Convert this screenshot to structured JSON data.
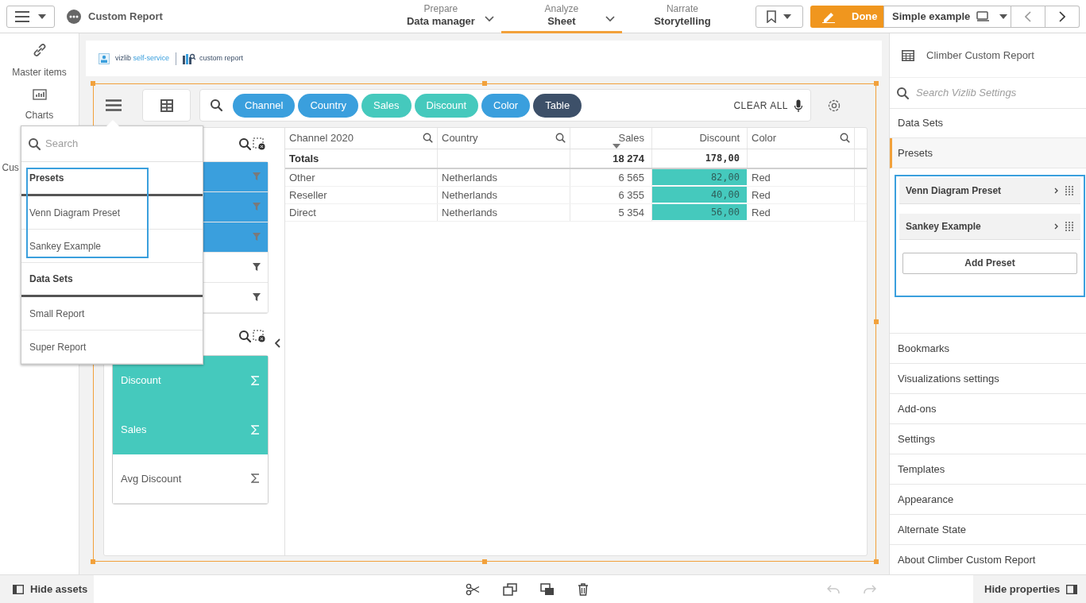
{
  "top_bar": {
    "title": "Custom Report",
    "tabs": [
      {
        "caption": "Prepare",
        "label": "Data manager",
        "selected": false,
        "dropdown": true
      },
      {
        "caption": "Analyze",
        "label": "Sheet",
        "selected": true,
        "dropdown": true
      },
      {
        "caption": "Narrate",
        "label": "Storytelling",
        "selected": false,
        "dropdown": false
      }
    ],
    "done_button": "Done",
    "sheet_button": "Simple example"
  },
  "assets_panel": {
    "items": [
      {
        "kind": "link",
        "label": "Master items"
      },
      {
        "kind": "chart",
        "label": "Charts"
      },
      {
        "kind": "text",
        "label": "Cus"
      }
    ]
  },
  "report_header": {
    "brand": "vizlib",
    "brand_accent": "self-service",
    "product": "custom report"
  },
  "toolbar": {
    "chips": [
      {
        "label": "Channel",
        "color": "#3a9fdd"
      },
      {
        "label": "Country",
        "color": "#3a9fdd"
      },
      {
        "label": "Sales",
        "color": "#45c9bd"
      },
      {
        "label": "Discount",
        "color": "#45c9bd"
      },
      {
        "label": "Color",
        "color": "#3a9fdd"
      },
      {
        "label": "Table",
        "color": "#3d5069"
      }
    ],
    "clear_all": "CLEAR ALL"
  },
  "dimensions": {
    "rows": [
      {
        "selected": true
      },
      {
        "selected": true
      },
      {
        "selected": true
      },
      {
        "selected": false
      },
      {
        "selected": false
      }
    ]
  },
  "measures": {
    "rows": [
      {
        "label": "Discount",
        "selected": true
      },
      {
        "label": "Sales",
        "selected": true
      },
      {
        "label": "Avg Discount",
        "selected": false
      }
    ]
  },
  "table": {
    "columns": [
      {
        "label": "Channel 2020",
        "kind": "dimension",
        "sorted": false
      },
      {
        "label": "Country",
        "kind": "dimension",
        "sorted": false
      },
      {
        "label": "Sales",
        "kind": "measure",
        "sorted": true
      },
      {
        "label": "Discount",
        "kind": "measure",
        "sorted": false
      },
      {
        "label": "Color",
        "kind": "dimension",
        "sorted": false
      }
    ],
    "totals": {
      "label": "Totals",
      "sales": "18 274",
      "discount": "178,00"
    },
    "rows": [
      {
        "channel": "Other",
        "country": "Netherlands",
        "sales": "6 565",
        "discount": "82,00",
        "shade": "Red"
      },
      {
        "channel": "Reseller",
        "country": "Netherlands",
        "sales": "6 355",
        "discount": "40,00",
        "shade": "Red"
      },
      {
        "channel": "Direct",
        "country": "Netherlands",
        "sales": "5 354",
        "discount": "56,00",
        "shade": "Red"
      }
    ]
  },
  "dropdown": {
    "search_placeholder": "Search",
    "sections": [
      {
        "title": "Presets",
        "items": [
          "Venn Diagram Preset",
          "Sankey Example"
        ]
      },
      {
        "title": "Data Sets",
        "items": [
          "Small Report",
          "Super Report"
        ]
      }
    ]
  },
  "properties": {
    "title": "Climber Custom Report",
    "search_placeholder": "Search Vizlib Settings",
    "sections": [
      {
        "label": "Data Sets",
        "selected": false
      },
      {
        "label": "Presets",
        "selected": true
      }
    ],
    "presets": [
      "Venn Diagram Preset",
      "Sankey Example"
    ],
    "add_preset": "Add Preset",
    "more": [
      "Bookmarks",
      "Visualizations settings",
      "Add-ons",
      "Settings",
      "Templates",
      "Appearance",
      "Alternate State",
      "About Climber Custom Report"
    ]
  },
  "bottom_bar": {
    "hide_assets": "Hide assets",
    "hide_properties": "Hide properties"
  }
}
